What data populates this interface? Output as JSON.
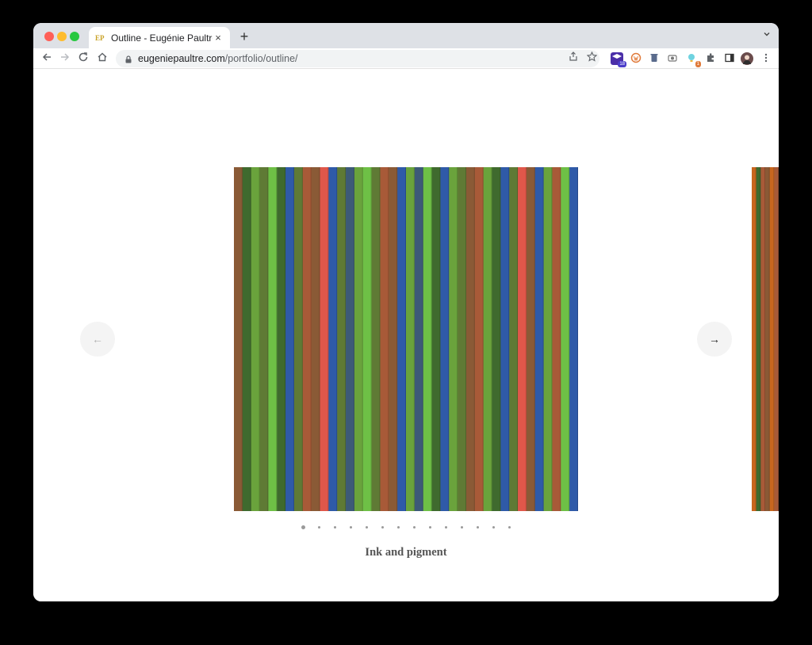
{
  "browser": {
    "tab": {
      "favicon": "EP",
      "title": "Outline - Eugénie Paultre",
      "close": "×"
    },
    "new_tab": "+",
    "tab_menu": "⌄",
    "url_host": "eugeniepaultre.com",
    "url_path": "/portfolio/outline/",
    "extension_badges": {
      "first": "18",
      "bulb": "1"
    }
  },
  "slider": {
    "prev_arrow": "←",
    "next_arrow": "→",
    "slide_count": 14,
    "active_index": 0,
    "caption": "Ink and pigment"
  },
  "colors": {
    "brown": "#8a5a36",
    "rust": "#a85a38",
    "olive": "#5f7a35",
    "green": "#6aa33c",
    "lime": "#6ec046",
    "dark_green": "#3f6a2e",
    "blue": "#2f5aa8",
    "slate": "#3d5a78",
    "red": "#e0574a",
    "orange": "#c8661e"
  },
  "artwork_stripes": [
    "brown",
    "dark_green",
    "green",
    "olive",
    "lime",
    "dark_green",
    "blue",
    "olive",
    "rust",
    "brown",
    "red",
    "blue",
    "olive",
    "slate",
    "green",
    "lime",
    "olive",
    "rust",
    "brown",
    "blue",
    "green",
    "slate",
    "lime",
    "dark_green",
    "blue",
    "green",
    "olive",
    "brown",
    "rust",
    "green",
    "dark_green",
    "blue",
    "olive",
    "red",
    "brown",
    "blue",
    "green",
    "rust",
    "lime",
    "blue"
  ],
  "peek_stripes": [
    "orange",
    "dark_green",
    "rust",
    "brown",
    "orange",
    "rust"
  ]
}
